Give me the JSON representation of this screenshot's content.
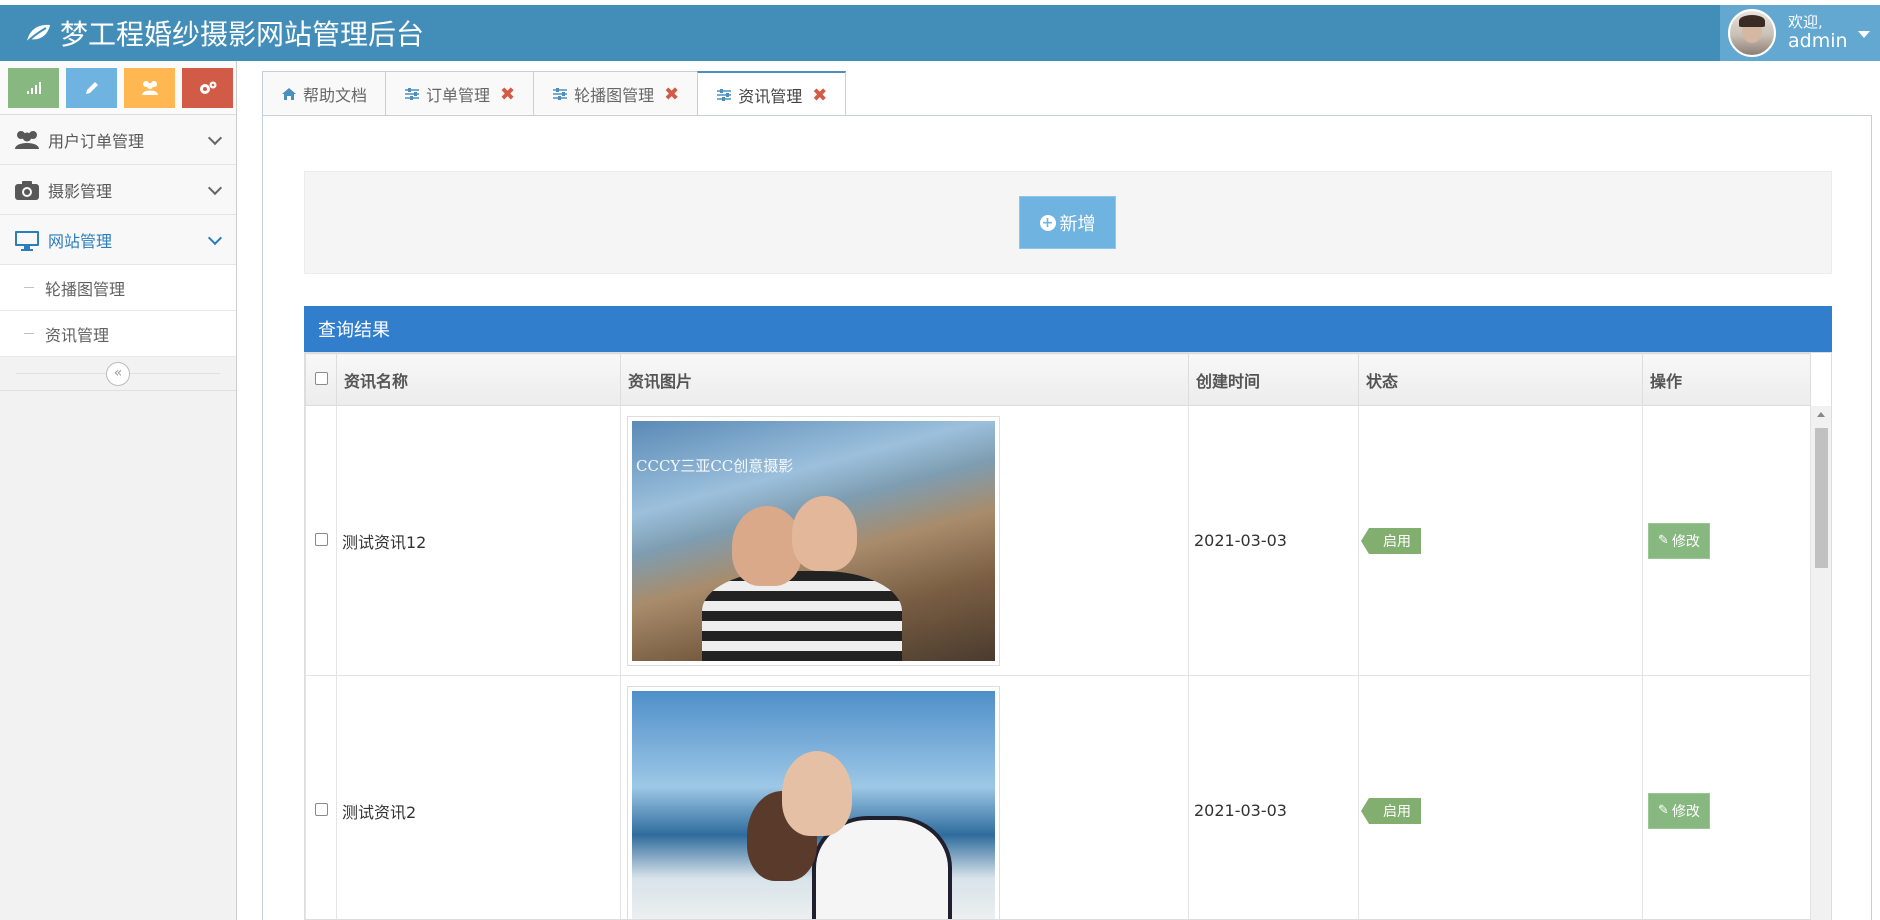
{
  "header": {
    "title": "梦工程婚纱摄影网站管理后台",
    "welcome": "欢迎,",
    "username": "admin",
    "bar_color": "#438eb9"
  },
  "shortcuts": [
    {
      "icon": "signal-icon",
      "color": "#87b87f"
    },
    {
      "icon": "pencil-icon",
      "color": "#6fb3e0"
    },
    {
      "icon": "users-icon",
      "color": "#ffb752"
    },
    {
      "icon": "cogs-icon",
      "color": "#d15b47"
    }
  ],
  "sidebar": {
    "items": [
      {
        "label": "用户订单管理",
        "icon": "users-icon"
      },
      {
        "label": "摄影管理",
        "icon": "camera-icon"
      },
      {
        "label": "网站管理",
        "icon": "desktop-icon",
        "active": true
      }
    ],
    "subitems": [
      {
        "label": "轮播图管理"
      },
      {
        "label": "资讯管理"
      }
    ]
  },
  "tabs": [
    {
      "label": "帮助文档",
      "icon": "home-icon",
      "closable": false
    },
    {
      "label": "订单管理",
      "icon": "sliders-icon",
      "closable": true
    },
    {
      "label": "轮播图管理",
      "icon": "sliders-icon",
      "closable": true
    },
    {
      "label": "资讯管理",
      "icon": "sliders-icon",
      "closable": true,
      "active": true
    }
  ],
  "toolbar": {
    "add_label": "新增"
  },
  "results": {
    "title": "查询结果",
    "columns": [
      "资讯名称",
      "资讯图片",
      "创建时间",
      "状态",
      "操作"
    ],
    "rows": [
      {
        "name": "测试资讯12",
        "image_watermark": "CCCY三亚CC创意摄影",
        "created": "2021-03-03",
        "status": "启用",
        "action": "修改"
      },
      {
        "name": "测试资讯2",
        "image_watermark": "",
        "created": "2021-03-03",
        "status": "启用",
        "action": "修改"
      }
    ]
  }
}
